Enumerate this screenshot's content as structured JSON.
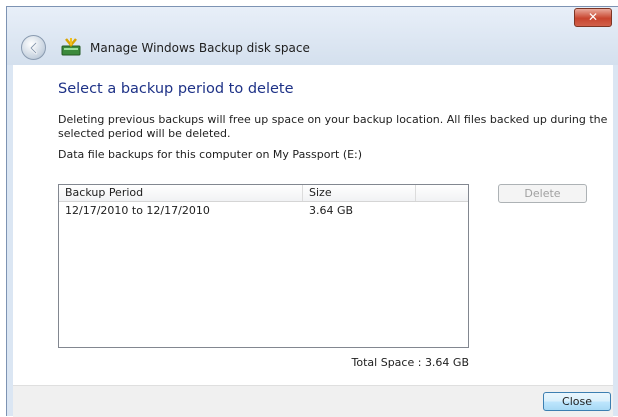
{
  "window": {
    "title": "Manage Windows Backup disk space",
    "close_glyph": "✕"
  },
  "main": {
    "heading": "Select a backup period to delete",
    "description": "Deleting previous backups will free up space on your backup location. All files backed up during the selected period will be deleted.",
    "data_location": "Data file backups for this computer on My Passport (E:)"
  },
  "list": {
    "columns": [
      "Backup Period",
      "Size",
      ""
    ],
    "rows": [
      {
        "period": "12/17/2010 to 12/17/2010",
        "size": "3.64 GB"
      }
    ]
  },
  "buttons": {
    "delete": "Delete",
    "close": "Close"
  },
  "total_space": "Total Space : 3.64 GB",
  "icons": {
    "back": "back-arrow-icon",
    "app": "windows-backup-icon",
    "close": "close-icon"
  },
  "colors": {
    "heading": "#1e3287",
    "title_close": "#c8452e"
  }
}
